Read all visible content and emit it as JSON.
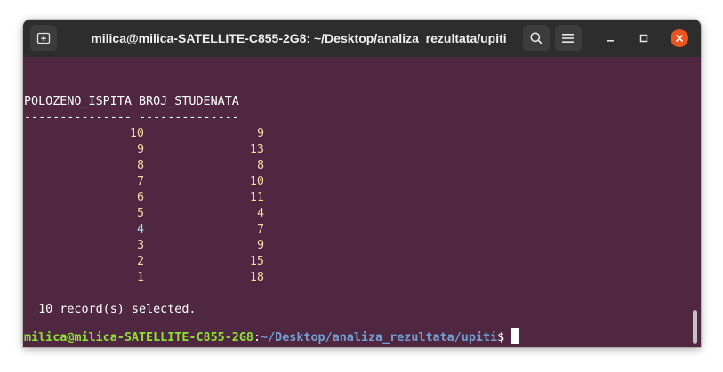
{
  "window": {
    "title": "milica@milica-SATELLITE-C855-2G8: ~/Desktop/analiza_rezultata/upiti",
    "buttons": {
      "new_tab_icon": "new-tab-icon",
      "search_icon": "search-icon",
      "menu_icon": "hamburger-menu-icon",
      "minimize_icon": "minimize-icon",
      "maximize_icon": "maximize-icon",
      "close_icon": "close-icon"
    },
    "colors": {
      "titlebar": "#2d2d2d",
      "terminal_bg": "#4f2740",
      "close": "#e95420",
      "prompt_user": "#8ae234",
      "prompt_path": "#729fcf"
    }
  },
  "terminal": {
    "header": "POLOZENO_ISPITA BROJ_STUDENATA",
    "separator": "--------------- --------------",
    "rows": [
      {
        "polozeno": "10",
        "broj": "9"
      },
      {
        "polozeno": "9",
        "broj": "13"
      },
      {
        "polozeno": "8",
        "broj": "8"
      },
      {
        "polozeno": "7",
        "broj": "10"
      },
      {
        "polozeno": "6",
        "broj": "11"
      },
      {
        "polozeno": "5",
        "broj": "4"
      },
      {
        "polozeno": "4",
        "broj": "7"
      },
      {
        "polozeno": "3",
        "broj": "9"
      },
      {
        "polozeno": "2",
        "broj": "15"
      },
      {
        "polozeno": "1",
        "broj": "18"
      }
    ],
    "summary": "  10 record(s) selected.",
    "prompt_user": "milica@milica-SATELLITE-C855-2G8",
    "prompt_sep": ":",
    "prompt_path": "~/Desktop/analiza_rezultata/upiti",
    "prompt_symbol": "$ "
  }
}
